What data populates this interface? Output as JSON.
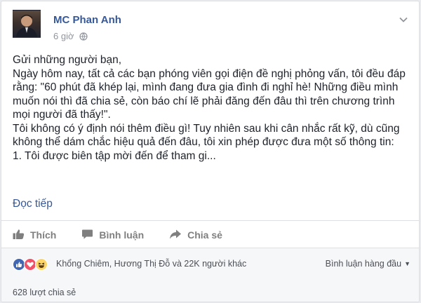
{
  "post": {
    "author": "MC Phan Anh",
    "time": "6 giờ",
    "paragraphs": [
      "Gửi những người bạn,",
      "Ngày hôm nay, tất cả các bạn phóng viên gọi điện đề nghị phỏng vấn, tôi đều đáp rằng: \"60 phút đã khép lại, mình đang đưa gia đình đi nghỉ hè! Những điều mình muốn nói thì đã chia sẻ, còn báo chí lẽ phải đăng đến đâu thì trên chương trình mọi người đã thấy!\".",
      "Tôi không có ý định nói thêm điều gì! Tuy nhiên sau khi cân nhắc rất kỹ, dù cũng không thể dám chắc hiệu quả đến đâu, tôi xin phép được đưa một số thông tin:",
      "1. Tôi được biên tập mời đến để tham gi..."
    ],
    "read_more": "Đọc tiếp"
  },
  "actions": {
    "like": "Thích",
    "comment": "Bình luận",
    "share": "Chia sẻ"
  },
  "reactions": {
    "icons": [
      "like-reaction-icon",
      "love-reaction-icon",
      "haha-reaction-icon"
    ],
    "summary": "Khổng Chiêm, Hương Thị Đỗ và 22K người khác",
    "top_comments": "Bình luận hàng đầu"
  },
  "shares": "628 lượt chia sẻ",
  "colors": {
    "link": "#365899",
    "text": "#1d2129",
    "muted": "#90949c",
    "like_blue": "#4267b2",
    "love_red": "#f25268",
    "haha_yellow": "#fcd669"
  }
}
